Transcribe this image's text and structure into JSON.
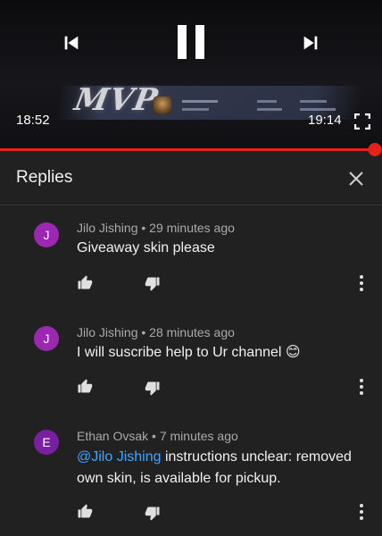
{
  "player": {
    "current_time": "18:52",
    "total_time": "19:14",
    "progress": 0.981,
    "overlay_text": "MVP",
    "accent_color": "#e62117",
    "icons": {
      "previous": "skip-previous-icon",
      "pause": "pause-icon",
      "next": "skip-next-icon",
      "fullscreen": "fullscreen-icon"
    }
  },
  "replies": {
    "title": "Replies",
    "close_icon": "close-icon",
    "comments": [
      {
        "avatar_letter": "J",
        "avatar_color": "#9c27b0",
        "author": "Jilo Jishing",
        "separator": "•",
        "time": "29 minutes ago",
        "text": "Giveaway skin please"
      },
      {
        "avatar_letter": "J",
        "avatar_color": "#9c27b0",
        "author": "Jilo Jishing",
        "separator": "•",
        "time": "28 minutes ago",
        "text": "I will suscribe help to Ur channel",
        "emoji": "😊"
      },
      {
        "avatar_letter": "E",
        "avatar_color": "#7b1fa2",
        "author": "Ethan Ovsak",
        "separator": "•",
        "time": "7 minutes ago",
        "mention": "@Jilo Jishing",
        "text": "instructions unclear: removed own skin, is available for pickup."
      }
    ],
    "action_icons": {
      "like": "thumbs-up-icon",
      "dislike": "thumbs-down-icon",
      "more": "more-vert-icon"
    },
    "mention_color": "#3ea6ff"
  }
}
